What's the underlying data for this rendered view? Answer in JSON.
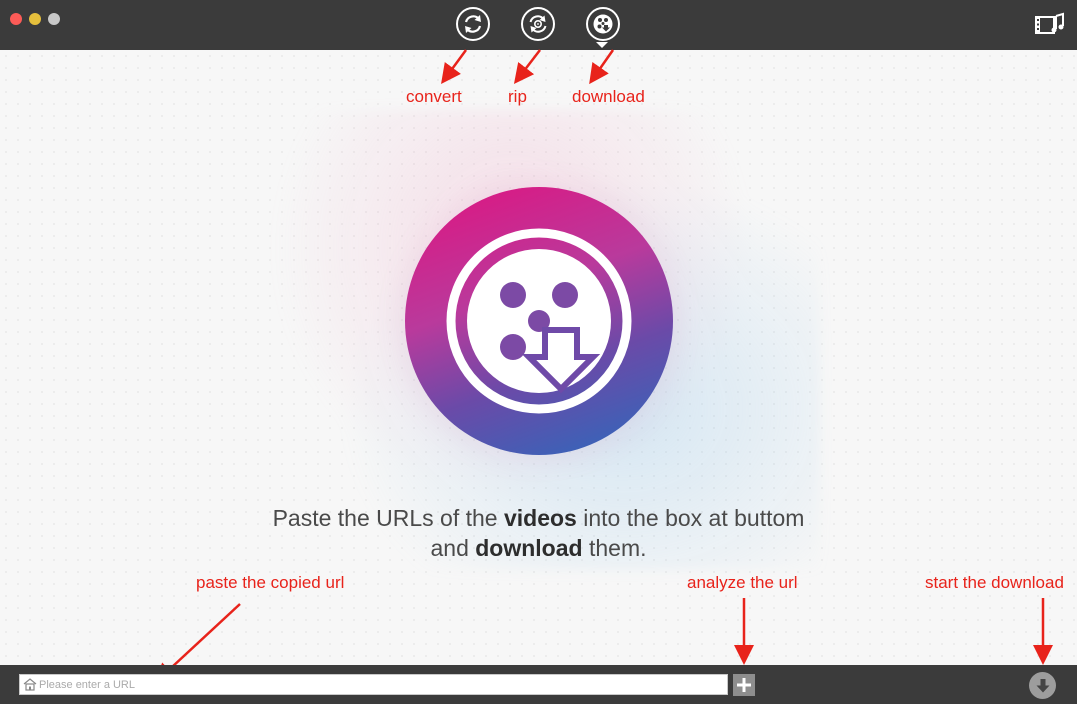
{
  "titlebar": {
    "modes": [
      {
        "name": "convert",
        "icon": "convert-icon"
      },
      {
        "name": "rip",
        "icon": "rip-icon"
      },
      {
        "name": "download",
        "icon": "download-mode-icon",
        "active": true
      }
    ],
    "media_icon": "media-browser-icon"
  },
  "annotations": {
    "convert": "convert",
    "rip": "rip",
    "download": "download",
    "paste": "paste the copied url",
    "analyze": "analyze the url",
    "start": "start the download"
  },
  "main": {
    "logo_icon": "video-download-logo-icon",
    "tagline": {
      "p1": "Paste the URLs of the ",
      "b1": "videos",
      "p2": " into the box at buttom",
      "p3": "and ",
      "b2": "download",
      "p4": " them."
    }
  },
  "bottom": {
    "url_placeholder": "Please enter a URL",
    "url_value": "",
    "add_icon": "plus-icon",
    "download_icon": "download-arrow-icon"
  },
  "colors": {
    "annotation": "#e8231b",
    "bar": "#3b3b3b",
    "logo_gradient": [
      "#e0137f",
      "#6b4aa8",
      "#2a6bbd"
    ]
  }
}
